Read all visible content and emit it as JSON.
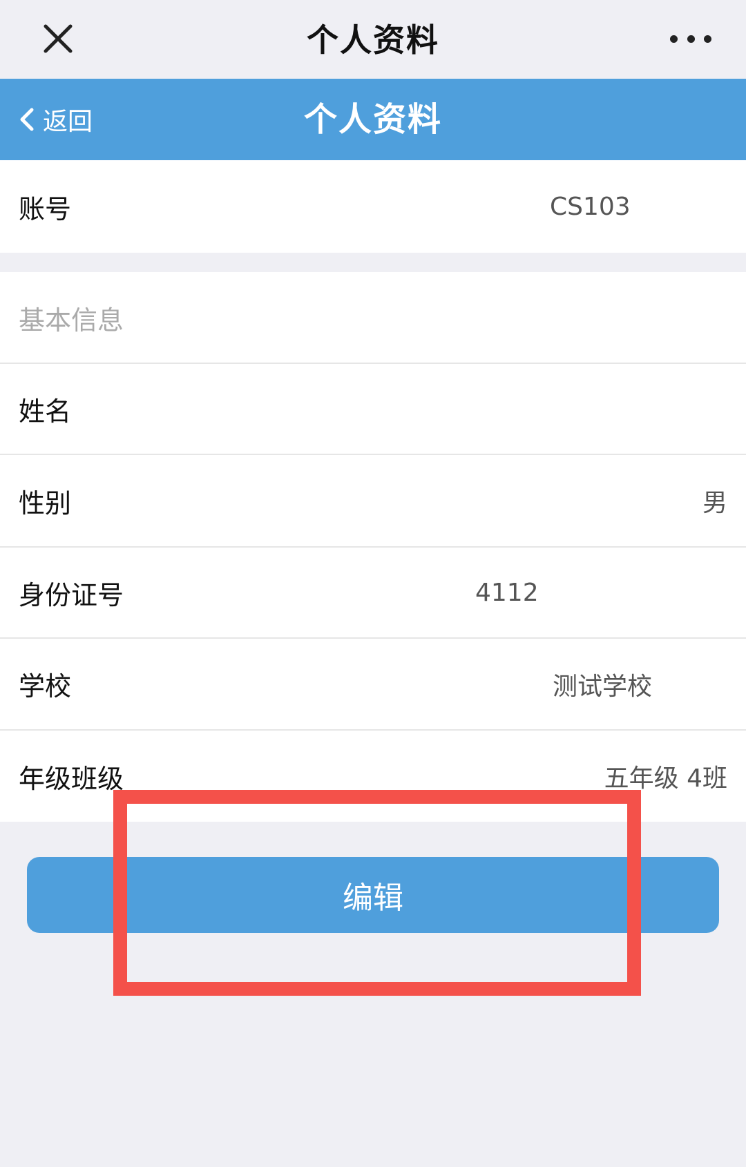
{
  "topbar": {
    "title": "个人资料",
    "close_icon": "close-icon",
    "more_icon": "more-icon"
  },
  "header": {
    "back_label": "返回",
    "title": "个人资料",
    "color": "#4f9fdc"
  },
  "account": {
    "label": "账号",
    "value": "CS103"
  },
  "basic_info": {
    "section_title": "基本信息",
    "fields": [
      {
        "label": "姓名",
        "value": ""
      },
      {
        "label": "性别",
        "value": "男"
      },
      {
        "label": "身份证号",
        "value": "4112"
      },
      {
        "label": "学校",
        "value": "测试学校"
      },
      {
        "label": "年级班级",
        "value": "五年级 4班"
      }
    ]
  },
  "edit_button": {
    "label": "编辑"
  },
  "highlight": {
    "color": "#f4514a"
  }
}
